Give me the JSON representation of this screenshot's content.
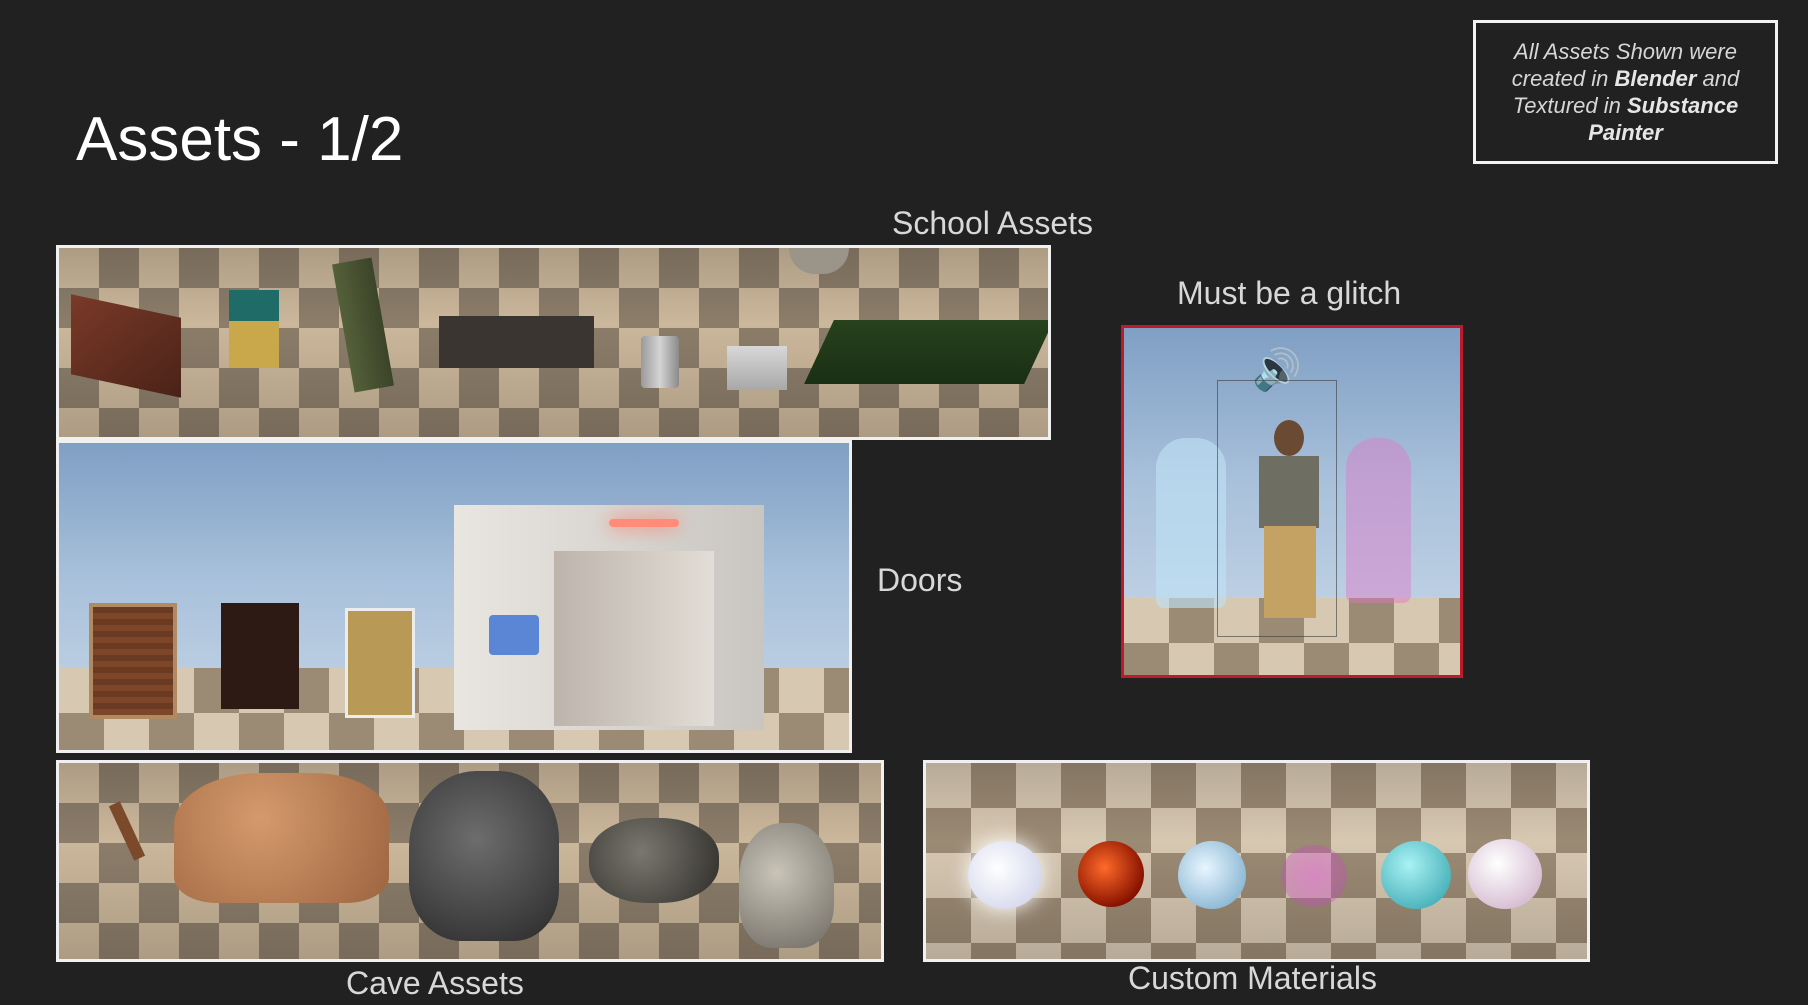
{
  "slide": {
    "title": "Assets - 1/2"
  },
  "note": {
    "line1": "All Assets Shown were created in ",
    "blender": "Blender",
    "line2": " and Textured in ",
    "substance": "Substance Painter"
  },
  "captions": {
    "school": "School Assets",
    "doors": "Doors",
    "glitch": "Must be a glitch",
    "cave": "Cave Assets",
    "materials": "Custom Materials"
  },
  "colors": {
    "background": "#212121",
    "frame": "#f0f0f0",
    "glitch_frame": "#c0192c"
  }
}
